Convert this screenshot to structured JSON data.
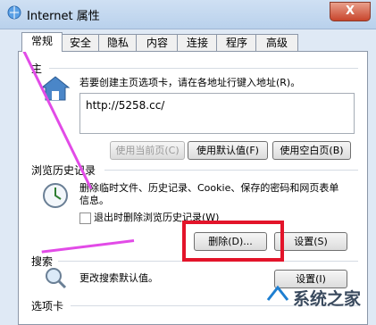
{
  "window": {
    "title": "Internet 属性",
    "close_label": "X"
  },
  "tabs": [
    "常规",
    "安全",
    "隐私",
    "内容",
    "连接",
    "程序",
    "高级"
  ],
  "homepage": {
    "label_partial": "主",
    "description": "若要创建主页选项卡，请在各地址行键入地址(R)。",
    "url": "http://5258.cc/",
    "btn_current": "使用当前页(C)",
    "btn_default": "使用默认值(F)",
    "btn_blank": "使用空白页(B)"
  },
  "history": {
    "label": "浏览历史记录",
    "description": "删除临时文件、历史记录、Cookie、保存的密码和网页表单信息。",
    "checkbox_label": "退出时删除浏览历史记录(W)",
    "btn_delete": "删除(D)...",
    "btn_settings": "设置(S)"
  },
  "search": {
    "label": "搜索",
    "description": "更改搜索默认值。",
    "btn_settings": "设置(I)"
  },
  "tabs_section": {
    "label": "选项卡"
  },
  "watermark": {
    "text": "系统之家"
  },
  "colors": {
    "arrow": "#e24be7",
    "highlight": "#e3142a"
  }
}
